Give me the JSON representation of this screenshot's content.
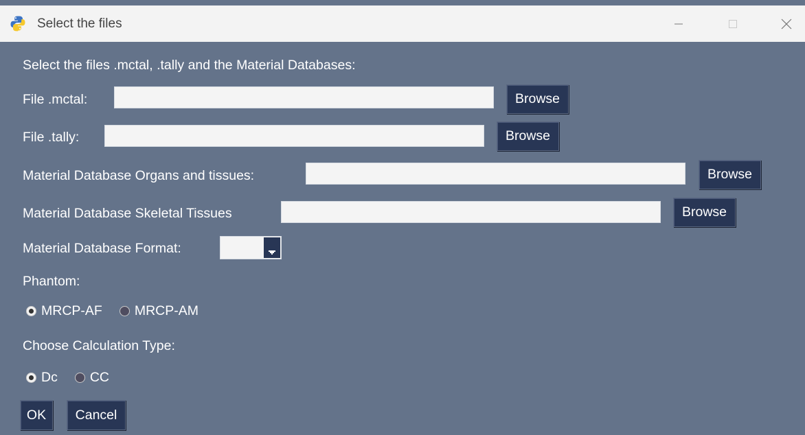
{
  "window": {
    "title": "Select the files",
    "icon": "python-icon",
    "controls": [
      "minimize-icon",
      "maximize-icon",
      "close-icon"
    ]
  },
  "form": {
    "intro": "Select the files .mctal, .tally and the Material Databases:",
    "fields": [
      {
        "label": "File .mctal:",
        "value": "",
        "button": "Browse"
      },
      {
        "label": "File .tally:",
        "value": "",
        "button": "Browse"
      },
      {
        "label": "Material Database Organs and tissues:",
        "value": "",
        "button": "Browse"
      },
      {
        "label": "Material Database Skeletal Tissues",
        "value": "",
        "button": "Browse"
      }
    ],
    "format": {
      "label": "Material Database Format:",
      "value": ""
    },
    "phantom": {
      "label": "Phantom:",
      "options": [
        {
          "label": "MRCP-AF",
          "selected": true
        },
        {
          "label": "MRCP-AM",
          "selected": false
        }
      ]
    },
    "calc": {
      "label": "Choose Calculation Type:",
      "options": [
        {
          "label": "Dc",
          "selected": true
        },
        {
          "label": "CC",
          "selected": false
        }
      ]
    },
    "ok": "OK",
    "cancel": "Cancel"
  },
  "colors": {
    "background": "#64738a",
    "button": "#283655",
    "titlebar": "#f3f3f3"
  }
}
